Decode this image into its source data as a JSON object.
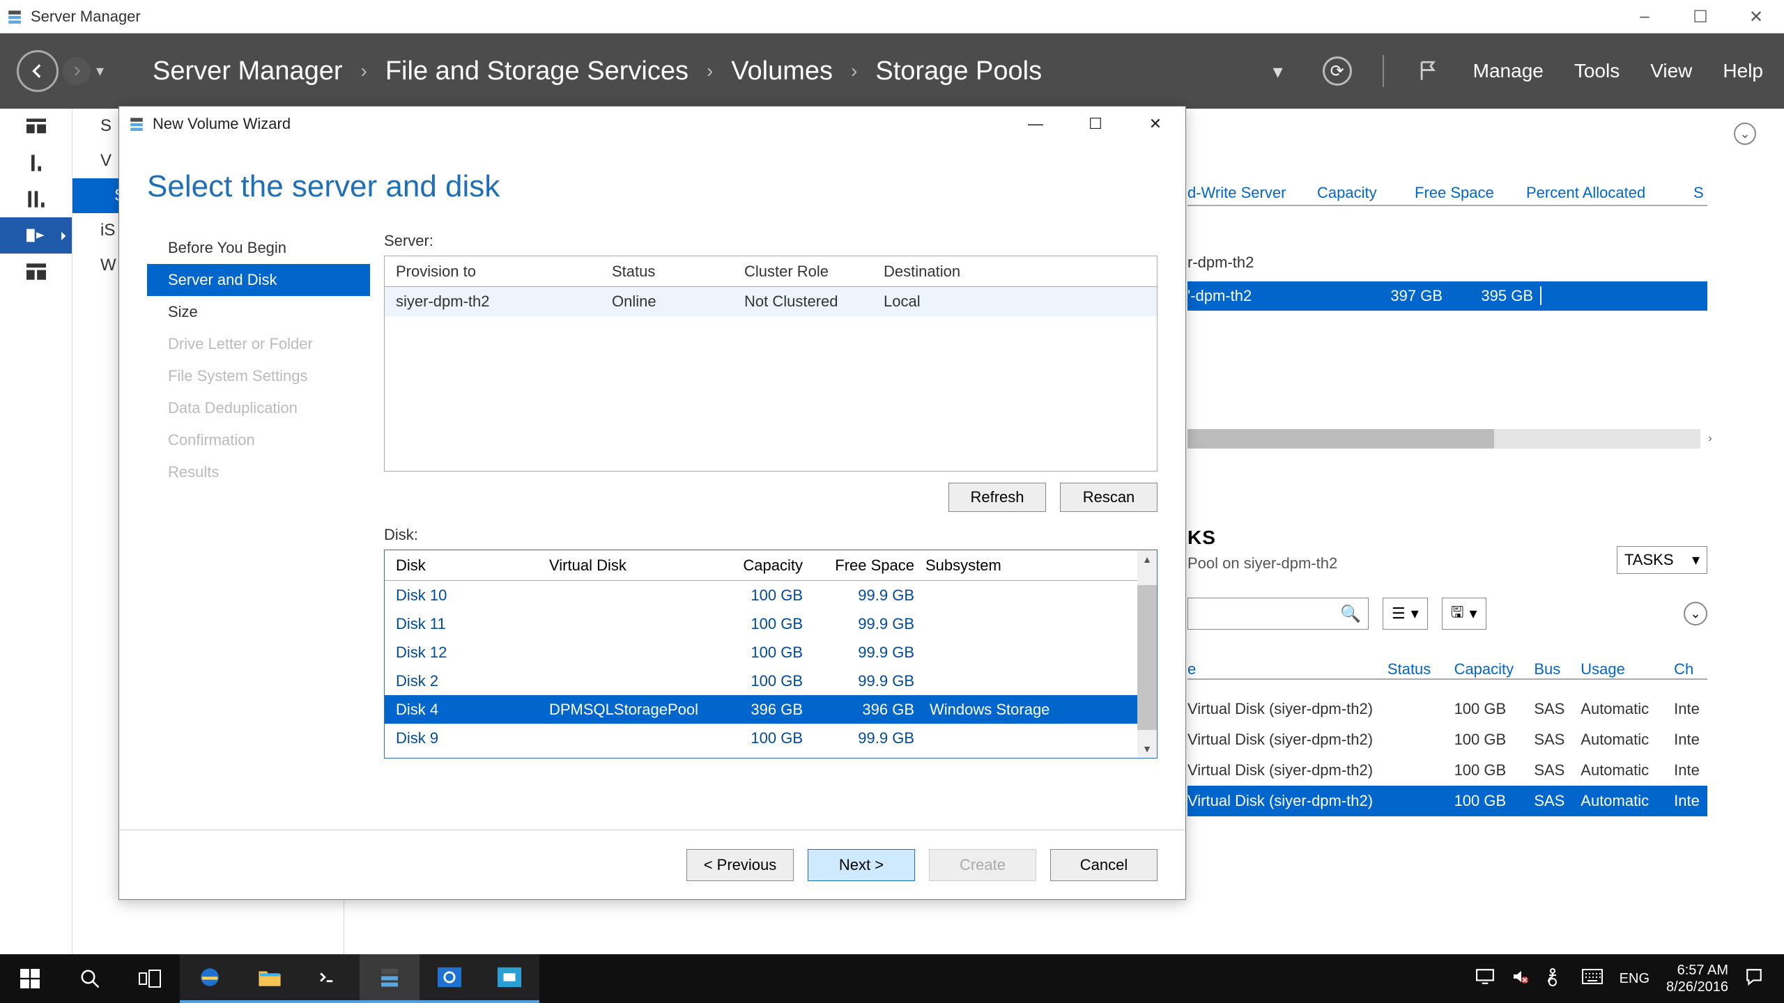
{
  "app": {
    "title": "Server Manager"
  },
  "window_controls": {
    "min": "–",
    "max": "☐",
    "close": "✕"
  },
  "breadcrumb": {
    "c1": "Server Manager",
    "c2": "File and Storage Services",
    "c3": "Volumes",
    "c4": "Storage Pools",
    "sep": "›"
  },
  "ribbon_menu": {
    "manage": "Manage",
    "tools": "Tools",
    "view": "View",
    "help": "Help"
  },
  "sidelist": {
    "i0": "S",
    "i1": "V",
    "i2": "S",
    "i3": "iS",
    "i4": "W"
  },
  "bg_pool": {
    "col_rw": "d-Write Server",
    "col_cap": "Capacity",
    "col_free": "Free Space",
    "col_pa": "Percent Allocated",
    "col_s": "S",
    "heading": "r-dpm-th2",
    "row_srv": "'-dpm-th2",
    "row_cap": "397 GB",
    "row_free": "395 GB"
  },
  "ks": {
    "title": "KS",
    "sub": "Pool on siyer-dpm-th2",
    "tasks": "TASKS",
    "col_e": "e",
    "col_status": "Status",
    "col_cap": "Capacity",
    "col_bus": "Bus",
    "col_usage": "Usage",
    "col_ch": "Ch",
    "vd_name": "Virtual Disk (siyer-dpm-th2)",
    "vd_cap": "100 GB",
    "vd_bus": "SAS",
    "vd_usage": "Automatic",
    "vd_ch": "Inte"
  },
  "wizard": {
    "title": "New Volume Wizard",
    "heading": "Select the server and disk",
    "steps": {
      "s0": "Before You Begin",
      "s1": "Server and Disk",
      "s2": "Size",
      "s3": "Drive Letter or Folder",
      "s4": "File System Settings",
      "s5": "Data Deduplication",
      "s6": "Confirmation",
      "s7": "Results"
    },
    "server_label": "Server:",
    "server_head": {
      "prov": "Provision to",
      "status": "Status",
      "cluster": "Cluster Role",
      "dest": "Destination"
    },
    "server_row": {
      "prov": "siyer-dpm-th2",
      "status": "Online",
      "cluster": "Not Clustered",
      "dest": "Local"
    },
    "btn_refresh": "Refresh",
    "btn_rescan": "Rescan",
    "disk_label": "Disk:",
    "disk_head": {
      "disk": "Disk",
      "vd": "Virtual Disk",
      "cap": "Capacity",
      "free": "Free Space",
      "sub": "Subsystem"
    },
    "disks": [
      {
        "disk": "Disk 10",
        "vd": "",
        "cap": "100 GB",
        "free": "99.9 GB",
        "sub": ""
      },
      {
        "disk": "Disk 11",
        "vd": "",
        "cap": "100 GB",
        "free": "99.9 GB",
        "sub": ""
      },
      {
        "disk": "Disk 12",
        "vd": "",
        "cap": "100 GB",
        "free": "99.9 GB",
        "sub": ""
      },
      {
        "disk": "Disk 2",
        "vd": "",
        "cap": "100 GB",
        "free": "99.9 GB",
        "sub": ""
      },
      {
        "disk": "Disk 4",
        "vd": "DPMSQLStoragePool",
        "cap": "396 GB",
        "free": "396 GB",
        "sub": "Windows Storage",
        "sel": true
      },
      {
        "disk": "Disk 9",
        "vd": "",
        "cap": "100 GB",
        "free": "99.9 GB",
        "sub": ""
      }
    ],
    "nav": {
      "prev": "<  Previous",
      "next": "Next  >",
      "create": "Create",
      "cancel": "Cancel"
    }
  },
  "taskbar": {
    "lang": "ENG",
    "time": "6:57 AM",
    "date": "8/26/2016"
  }
}
